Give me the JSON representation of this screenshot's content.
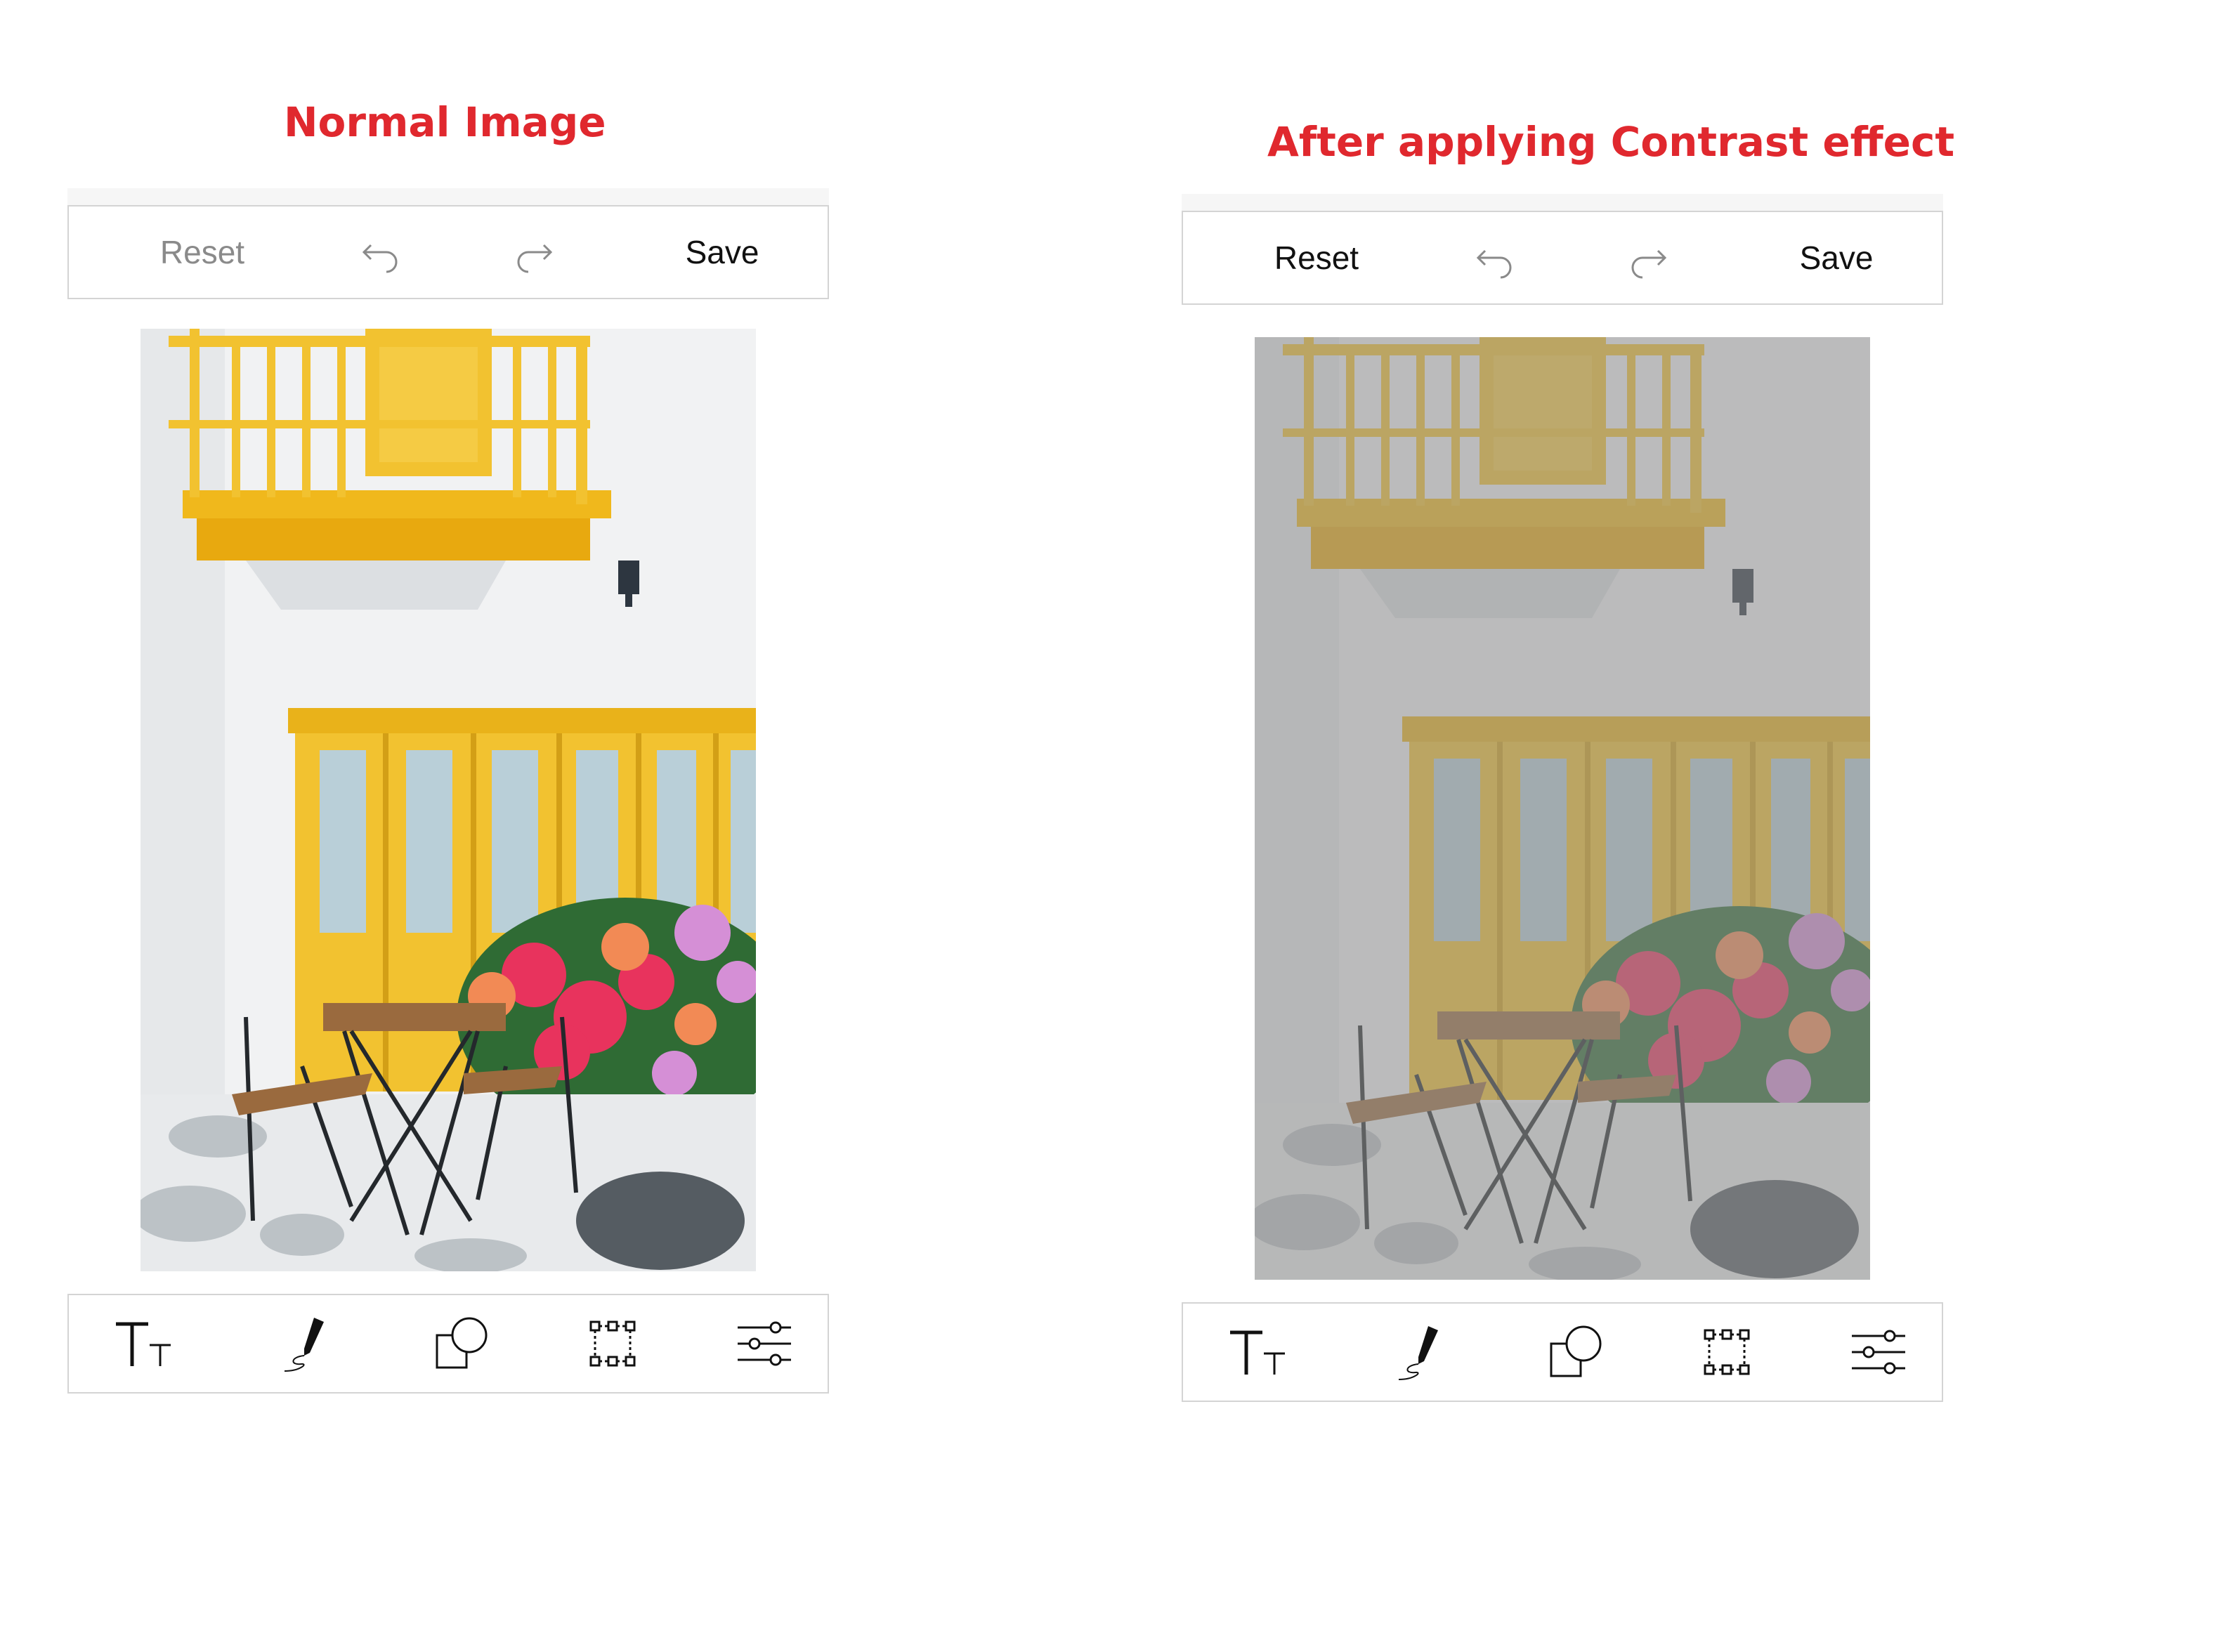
{
  "headings": {
    "left": "Normal Image",
    "right": "After applying Contrast effect"
  },
  "left_panel": {
    "toolbar": {
      "reset_label": "Reset",
      "save_label": "Save",
      "undo_icon": "undo-icon",
      "redo_icon": "redo-icon",
      "reset_color": "#8a8a8a"
    },
    "image": "yellow balcony, yellow doors, flowers and bistro chairs"
  },
  "right_panel": {
    "toolbar": {
      "reset_label": "Reset",
      "save_label": "Save",
      "undo_icon": "undo-icon",
      "redo_icon": "redo-icon",
      "reset_color": "#111111"
    },
    "image": "same photo with contrast effect applied (washed out grey)"
  },
  "bottom_tools": [
    "text-icon",
    "freehand-draw-icon",
    "shapes-icon",
    "crop-transform-icon",
    "filter-adjust-icon"
  ],
  "colors": {
    "heading": "#e0282e",
    "border": "#d4d4d4",
    "yellow": "#f3c22e"
  }
}
